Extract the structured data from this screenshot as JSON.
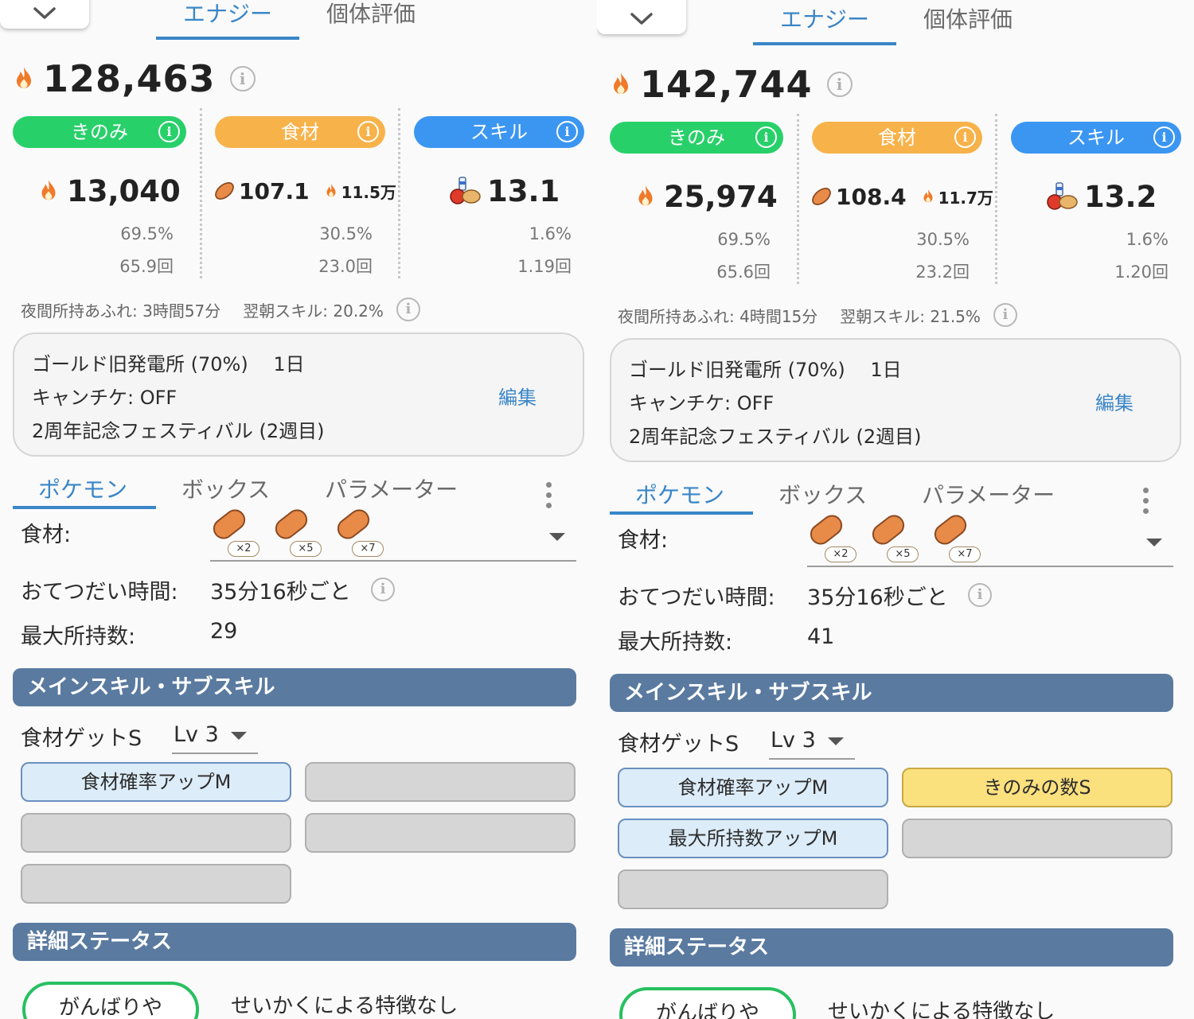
{
  "tabs": {
    "energy": "エナジー",
    "rating": "個体評価"
  },
  "categories": {
    "berry": "きのみ",
    "ingredient": "食材",
    "skill": "スキル"
  },
  "info_glyph": "i",
  "icons": {
    "collapse": "chevron-down-icon",
    "flame": "flame-icon",
    "bean": "bean-icon",
    "skill": "skill-bundle-icon",
    "info": "info-icon",
    "menu": "kebab-menu-icon"
  },
  "colors": {
    "accent": "#3a86c8",
    "berry": "#28d06a",
    "ingredient": "#f7b24a",
    "skill": "#3b96f2",
    "section_header": "#5a7aa0",
    "nature": "#28c060"
  },
  "sub_tabs": {
    "pokemon": "ポケモン",
    "box": "ボックス",
    "params": "パラメーター"
  },
  "labels": {
    "ingredients": "食材:",
    "help_time": "おてつだい時間:",
    "max_carry": "最大所持数:",
    "skills_section": "メインスキル・サブスキル",
    "detail_section": "詳細ステータス",
    "edit": "編集"
  },
  "panels": [
    {
      "total": "128,463",
      "berry": {
        "value": "13,040",
        "pct": "69.5%",
        "count": "65.9回"
      },
      "ingredient": {
        "value": "107.1",
        "energy": "11.5万",
        "pct": "30.5%",
        "count": "23.0回"
      },
      "skill": {
        "value": "13.1",
        "pct": "1.6%",
        "count": "1.19回"
      },
      "night_overflow": "夜間所持あふれ: 3時間57分",
      "morning_skill": "翌朝スキル: 20.2%",
      "settings": {
        "field": "ゴールド旧発電所 (70%)　 1日",
        "candy": "キャンチケ: OFF",
        "event": "2周年記念フェスティバル (2週目)"
      },
      "ingredient_counts": [
        "×2",
        "×5",
        "×7"
      ],
      "help_time": "35分16秒ごと",
      "max_carry": "29",
      "main_skill": "食材ゲットS",
      "skill_level": "Lv 3",
      "subskills": [
        "食材確率アップM",
        "",
        "",
        "",
        ""
      ],
      "nature": "がんばりや",
      "nature_desc": "せいかくによる特徴なし"
    },
    {
      "total": "142,744",
      "berry": {
        "value": "25,974",
        "pct": "69.5%",
        "count": "65.6回"
      },
      "ingredient": {
        "value": "108.4",
        "energy": "11.7万",
        "pct": "30.5%",
        "count": "23.2回"
      },
      "skill": {
        "value": "13.2",
        "pct": "1.6%",
        "count": "1.20回"
      },
      "night_overflow": "夜間所持あふれ: 4時間15分",
      "morning_skill": "翌朝スキル: 21.5%",
      "settings": {
        "field": "ゴールド旧発電所 (70%)　 1日",
        "candy": "キャンチケ: OFF",
        "event": "2周年記念フェスティバル (2週目)"
      },
      "ingredient_counts": [
        "×2",
        "×5",
        "×7"
      ],
      "help_time": "35分16秒ごと",
      "max_carry": "41",
      "main_skill": "食材ゲットS",
      "skill_level": "Lv 3",
      "subskills": [
        "食材確率アップM",
        "きのみの数S",
        "最大所持数アップM",
        "",
        ""
      ],
      "nature": "がんばりや",
      "nature_desc": "せいかくによる特徴なし"
    }
  ]
}
